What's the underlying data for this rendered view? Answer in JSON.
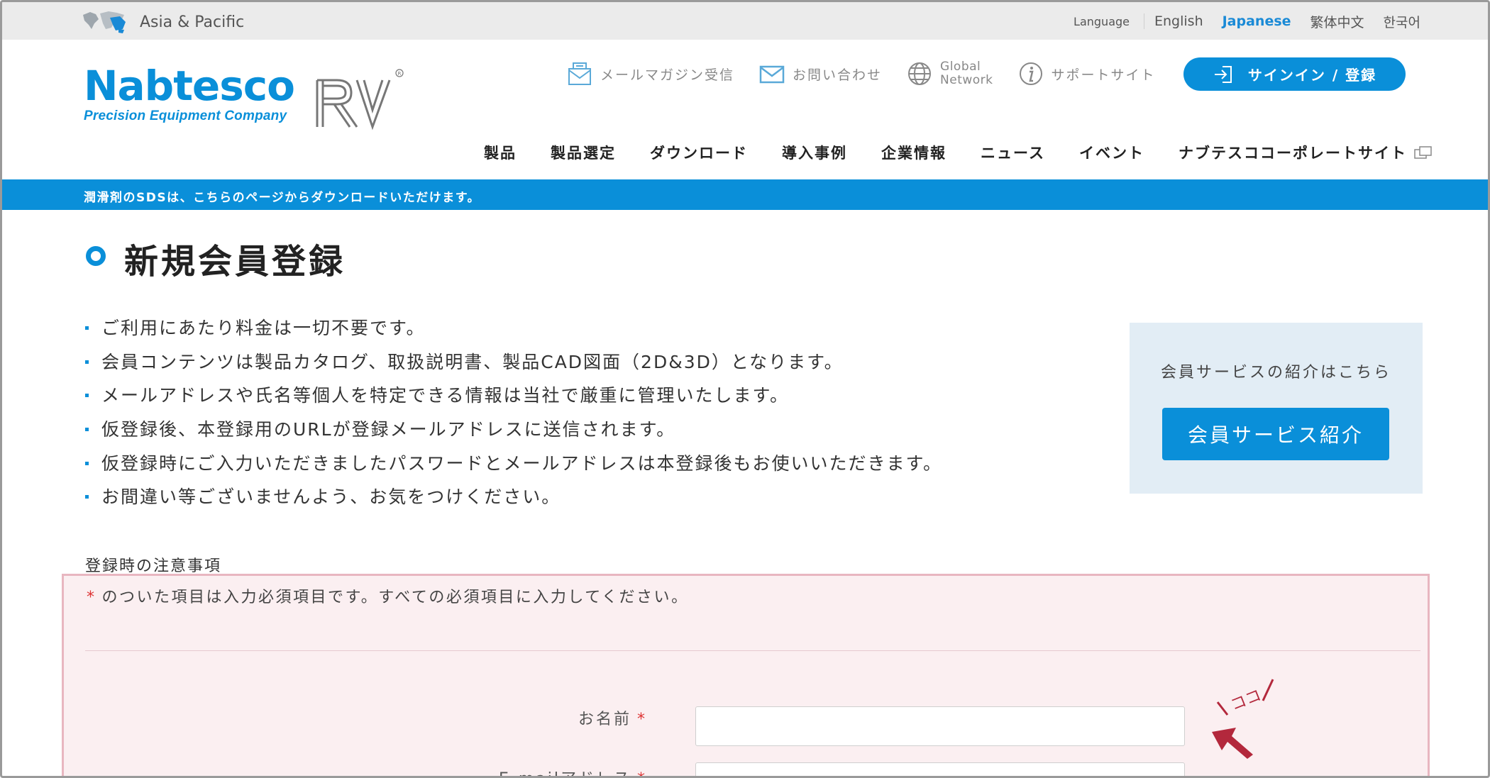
{
  "region": {
    "label": "Asia & Pacific"
  },
  "language": {
    "label": "Language",
    "options": [
      "English",
      "Japanese",
      "繁体中文",
      "한국어"
    ],
    "selected": "Japanese"
  },
  "brand": {
    "name": "Nabtesco",
    "subtitle": "Precision Equipment Company",
    "product_mark": "RV",
    "color": "#0a8fd9"
  },
  "utility_nav": {
    "newsletter": "メールマガジン受信",
    "contact": "お問い合わせ",
    "global_line1": "Global",
    "global_line2": "Network",
    "support": "サポートサイト",
    "signin": "サインイン / 登録"
  },
  "main_nav": [
    "製品",
    "製品選定",
    "ダウンロード",
    "導入事例",
    "企業情報",
    "ニュース",
    "イベント",
    "ナブテスココーポレートサイト"
  ],
  "notice": "潤滑剤のSDSは、こちらのページからダウンロードいただけます。",
  "page": {
    "title": "新規会員登録",
    "bullets": [
      "ご利用にあたり料金は一切不要です。",
      "会員コンテンツは製品カタログ、取扱説明書、製品CAD図面（2D&3D）となります。",
      "メールアドレスや氏名等個人を特定できる情報は当社で厳重に管理いたします。",
      "仮登録後、本登録用のURLが登録メールアドレスに送信されます。",
      "仮登録時にご入力いただきましたパスワードとメールアドレスは本登録後もお使いいただきます。",
      "お間違い等ございませんよう、お気をつけください。"
    ]
  },
  "service_box": {
    "text": "会員サービスの紹介はこちら",
    "button": "会員サービス紹介"
  },
  "form": {
    "notes_label": "登録時の注意事項",
    "required_mark": "*",
    "required_note": "のついた項目は入力必須項目です。すべての必須項目に入力してください。",
    "fields": [
      {
        "label": "お名前",
        "value": ""
      },
      {
        "label": "E-mailアドレス",
        "value": ""
      }
    ],
    "pointer_text": "ココ"
  }
}
